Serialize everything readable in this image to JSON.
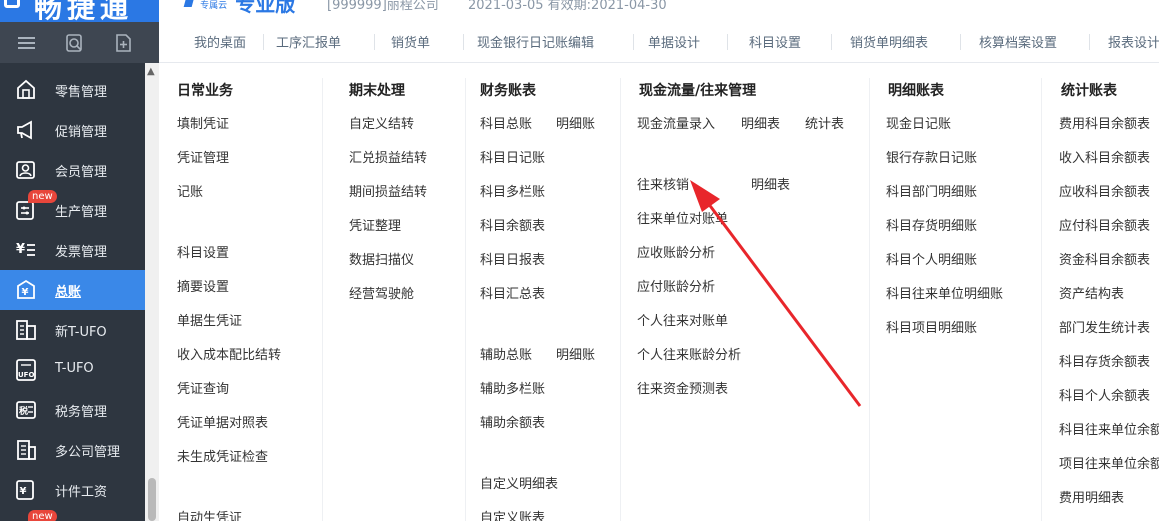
{
  "app": {
    "logo_text": "畅捷通",
    "brand_small": "专属云",
    "brand_big": "专业版",
    "company": "[999999]丽程公司",
    "dates": "2021-03-05    有效期:2021-04-30"
  },
  "tabs": [
    "我的桌面",
    "工序汇报单",
    "销货单",
    "现金银行日记账编辑",
    "单据设计",
    "科目设置",
    "销货单明细表",
    "核算档案设置",
    "报表设计"
  ],
  "sidebar": {
    "items": [
      {
        "label": "零售管理",
        "icon": "store-icon"
      },
      {
        "label": "促销管理",
        "icon": "megaphone-icon"
      },
      {
        "label": "会员管理",
        "icon": "member-card-icon"
      },
      {
        "label": "生产管理",
        "icon": "production-icon",
        "badge": "new"
      },
      {
        "label": "发票管理",
        "icon": "invoice-icon"
      },
      {
        "label": "总账",
        "icon": "ledger-icon",
        "active": true
      },
      {
        "label": "新T-UFO",
        "icon": "new-tufo-icon"
      },
      {
        "label": "T-UFO",
        "icon": "tufo-icon"
      },
      {
        "label": "税务管理",
        "icon": "tax-icon"
      },
      {
        "label": "多公司管理",
        "icon": "multi-company-icon"
      },
      {
        "label": "计件工资",
        "icon": "piece-wage-icon",
        "badge": "new"
      }
    ]
  },
  "menu": {
    "daily": {
      "title": "日常业务",
      "items": [
        "填制凭证",
        "凭证管理",
        "记账",
        "科目设置",
        "摘要设置",
        "单据生凭证",
        "收入成本配比结转",
        "凭证查询",
        "凭证单据对照表",
        "未生成凭证检查",
        "自动生凭证"
      ]
    },
    "period_end": {
      "title": "期末处理",
      "items": [
        "自定义结转",
        "汇兑损益结转",
        "期间损益结转",
        "凭证整理",
        "数据扫描仪",
        "经营驾驶舱"
      ]
    },
    "finance": {
      "title": "财务账表",
      "items": [
        "科目总账",
        "明细账",
        "科目日记账",
        "科目多栏账",
        "科目余额表",
        "科目日报表",
        "科目汇总表",
        "辅助总账",
        "明细账",
        "辅助多栏账",
        "辅助余额表",
        "自定义明细表",
        "自定义账表"
      ]
    },
    "cash": {
      "title": "现金流量/往来管理",
      "items": [
        "现金流量录入",
        "明细表",
        "统计表",
        "往来核销",
        "明细表",
        "往来单位对账单",
        "应收账龄分析",
        "应付账龄分析",
        "个人往来对账单",
        "个人往来账龄分析",
        "往来资金预测表"
      ]
    },
    "detail": {
      "title": "明细账表",
      "items": [
        "现金日记账",
        "银行存款日记账",
        "科目部门明细账",
        "科目存货明细账",
        "科目个人明细账",
        "科目往来单位明细账",
        "科目项目明细账"
      ]
    },
    "stats": {
      "title": "统计账表",
      "items": [
        "费用科目余额表",
        "收入科目余额表",
        "应收科目余额表",
        "应付科目余额表",
        "资金科目余额表",
        "资产结构表",
        "部门发生统计表",
        "科目存货余额表",
        "科目个人余额表",
        "科目往来单位余额表",
        "项目往来单位余额表",
        "费用明细表"
      ]
    }
  },
  "colors": {
    "sidebar_bg": "#2e3640",
    "sidebar_active": "#3a88e8",
    "brand_blue": "#2b78e4",
    "badge_red": "#e8463b",
    "annotation_red": "#e8262b"
  }
}
